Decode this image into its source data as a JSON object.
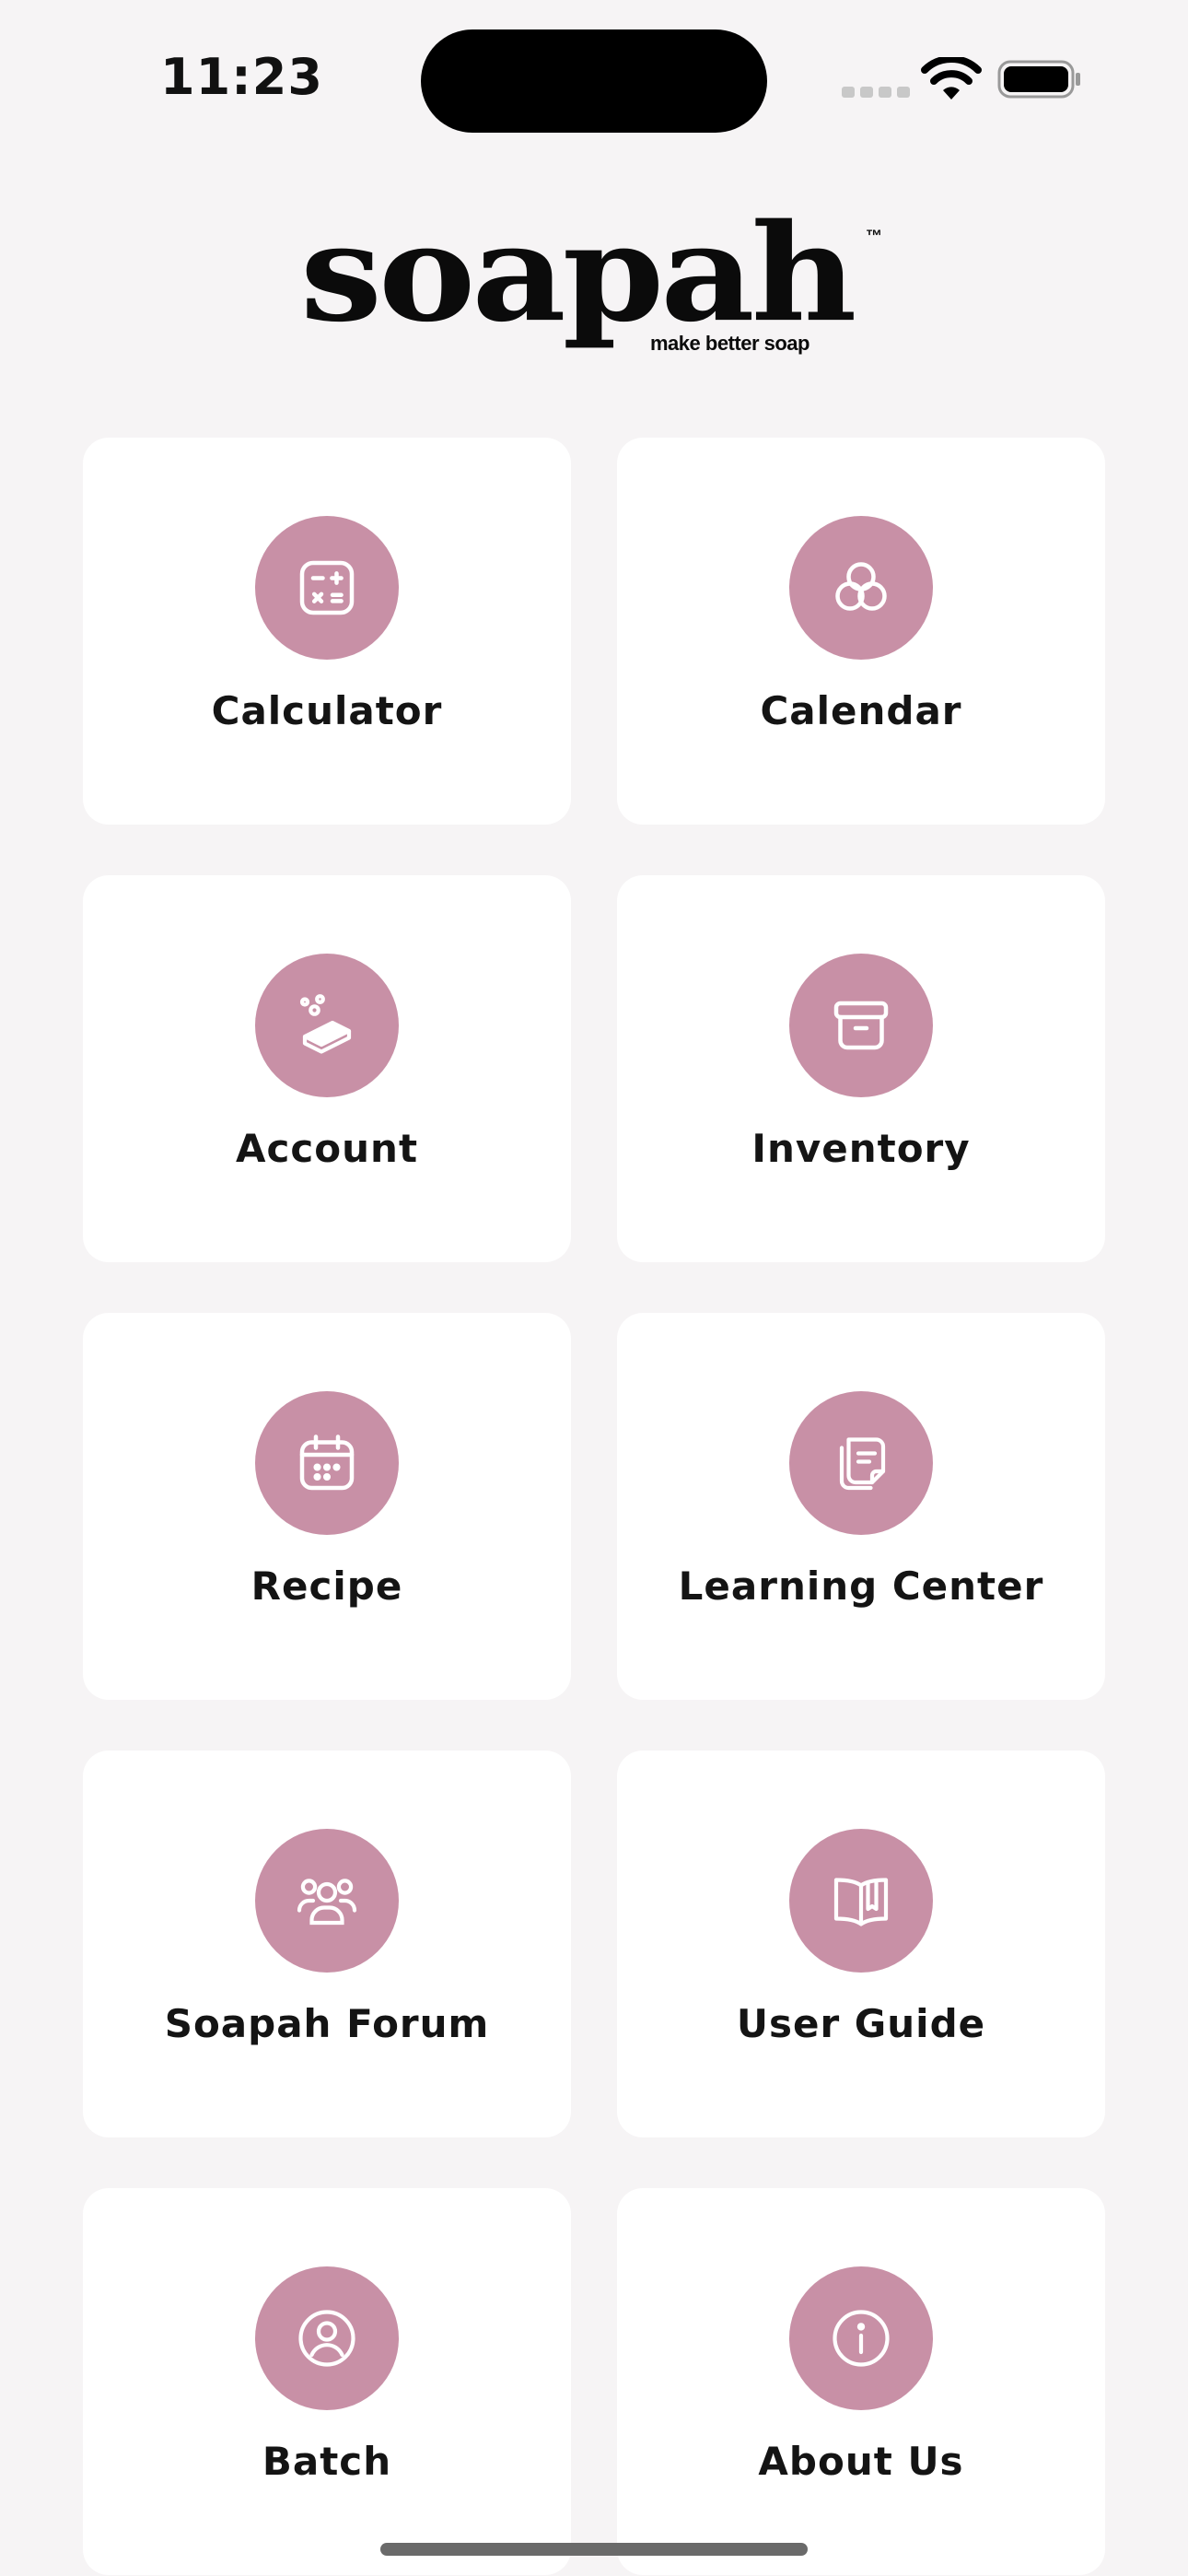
{
  "status_bar": {
    "time": "11:23"
  },
  "logo": {
    "word": "soapah",
    "trademark": "™",
    "tagline": "make better soap"
  },
  "accent_color": "#c890a6",
  "menu": [
    {
      "label": "Calculator",
      "icon": "calculator-icon"
    },
    {
      "label": "Calendar",
      "icon": "circles-icon"
    },
    {
      "label": "Account",
      "icon": "soap-bar-icon"
    },
    {
      "label": "Inventory",
      "icon": "archive-box-icon"
    },
    {
      "label": "Recipe",
      "icon": "calendar-icon"
    },
    {
      "label": "Learning Center",
      "icon": "documents-icon"
    },
    {
      "label": "Soapah Forum",
      "icon": "users-group-icon"
    },
    {
      "label": "User Guide",
      "icon": "open-book-icon"
    },
    {
      "label": "Batch",
      "icon": "user-circle-icon"
    },
    {
      "label": "About Us",
      "icon": "info-icon"
    }
  ]
}
